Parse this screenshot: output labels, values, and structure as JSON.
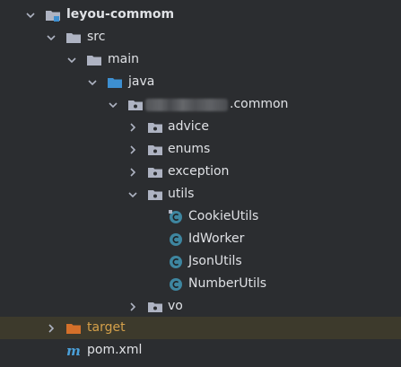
{
  "project_tree": {
    "root": {
      "label": "leyou-commom",
      "icon": "module-folder-icon"
    },
    "src": {
      "label": "src",
      "icon": "folder-icon"
    },
    "main": {
      "label": "main",
      "icon": "folder-icon"
    },
    "java": {
      "label": "java",
      "icon": "source-root-folder-icon",
      "color": "#3d8fd1"
    },
    "package": {
      "label": ".common",
      "icon": "package-icon"
    },
    "packages": [
      {
        "label": "advice",
        "icon": "package-icon"
      },
      {
        "label": "enums",
        "icon": "package-icon"
      },
      {
        "label": "exception",
        "icon": "package-icon"
      },
      {
        "label": "utils",
        "icon": "package-icon"
      }
    ],
    "classes": [
      {
        "label": "CookieUtils",
        "icon": "java-class-icon"
      },
      {
        "label": "IdWorker",
        "icon": "java-class-icon"
      },
      {
        "label": "JsonUtils",
        "icon": "java-class-icon"
      },
      {
        "label": "NumberUtils",
        "icon": "java-class-icon"
      }
    ],
    "vo": {
      "label": "vo",
      "icon": "package-icon"
    },
    "target": {
      "label": "target",
      "icon": "excluded-folder-icon",
      "color": "#d4a04a"
    },
    "pom": {
      "label": "pom.xml",
      "icon": "maven-icon"
    }
  },
  "colors": {
    "background": "#2b2d30",
    "highlight_row": "#3d3a2c",
    "class_icon": "#3e86a0",
    "folder": "#aeb3c2",
    "source_root": "#3d8fd1",
    "excluded": "#d4a04a"
  }
}
